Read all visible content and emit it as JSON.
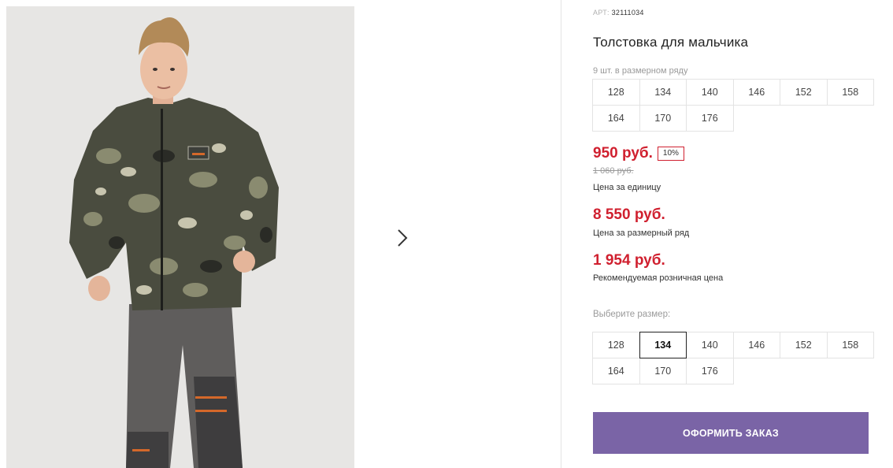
{
  "product": {
    "article_label": "АРТ:",
    "article_number": "32111034",
    "title": "Толстовка для мальчика",
    "pack_note": "9 шт. в размерном ряду",
    "pack_sizes": [
      "128",
      "134",
      "140",
      "146",
      "152",
      "158",
      "164",
      "170",
      "176"
    ]
  },
  "pricing": {
    "unit_price": "950 руб.",
    "discount": "10%",
    "old_price": "1 060 руб.",
    "unit_caption": "Цена за единицу",
    "pack_price": "8 550 руб.",
    "pack_caption": "Цена за размерный ряд",
    "retail_price": "1 954 руб.",
    "retail_caption": "Рекомендуемая розничная цена"
  },
  "size_selector": {
    "label": "Выберите размер:",
    "sizes": [
      "128",
      "134",
      "140",
      "146",
      "152",
      "158",
      "164",
      "170",
      "176"
    ],
    "selected": "134"
  },
  "actions": {
    "order_label": "ОФОРМИТЬ ЗАКАЗ"
  },
  "icons": {
    "next": "chevron-right-icon"
  },
  "colors": {
    "price_red": "#d0202f",
    "button_purple": "#7a64a6",
    "photo_bg": "#e7e6e4"
  }
}
